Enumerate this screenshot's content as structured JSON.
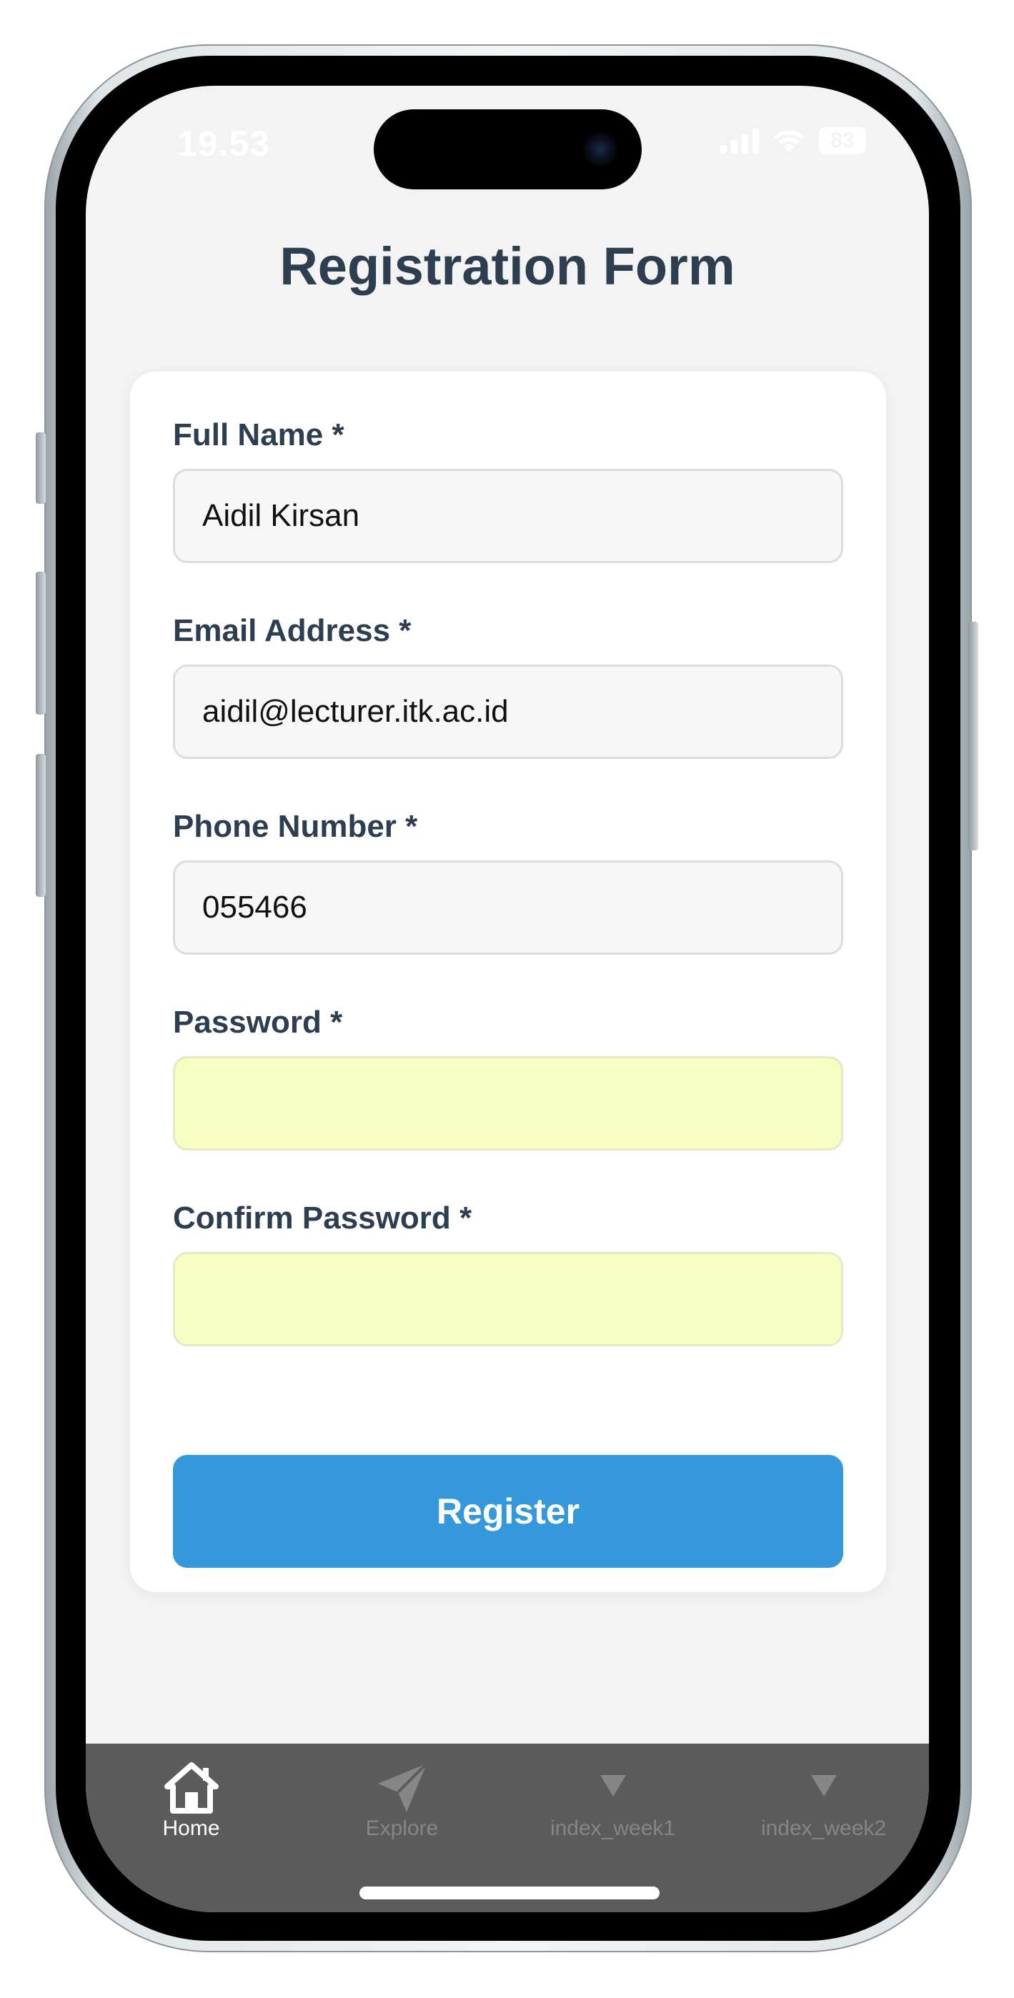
{
  "status_bar": {
    "time": "19.53",
    "battery": "83"
  },
  "page": {
    "title": "Registration Form"
  },
  "form": {
    "fields": [
      {
        "label": "Full Name *",
        "value": "Aidil Kirsan",
        "autofill": false
      },
      {
        "label": "Email Address *",
        "value": "aidil@lecturer.itk.ac.id",
        "autofill": false
      },
      {
        "label": "Phone Number *",
        "value": "055466",
        "autofill": false
      },
      {
        "label": "Password *",
        "value": "",
        "autofill": true
      },
      {
        "label": "Confirm Password *",
        "value": "",
        "autofill": true
      }
    ],
    "submit_label": "Register"
  },
  "tab_bar": {
    "tabs": [
      {
        "label": "Home",
        "icon": "home-icon",
        "active": true
      },
      {
        "label": "Explore",
        "icon": "paper-plane-icon",
        "active": false
      },
      {
        "label": "index_week1",
        "icon": "triangle-down-icon",
        "active": false
      },
      {
        "label": "index_week2",
        "icon": "triangle-down-icon",
        "active": false
      }
    ]
  },
  "colors": {
    "title": "#2c3e50",
    "button": "#3598db",
    "autofill": "#f8fdc2",
    "tab_bar": "#5b5b5b",
    "tab_active": "#ffffff",
    "tab_inactive": "#868686"
  }
}
